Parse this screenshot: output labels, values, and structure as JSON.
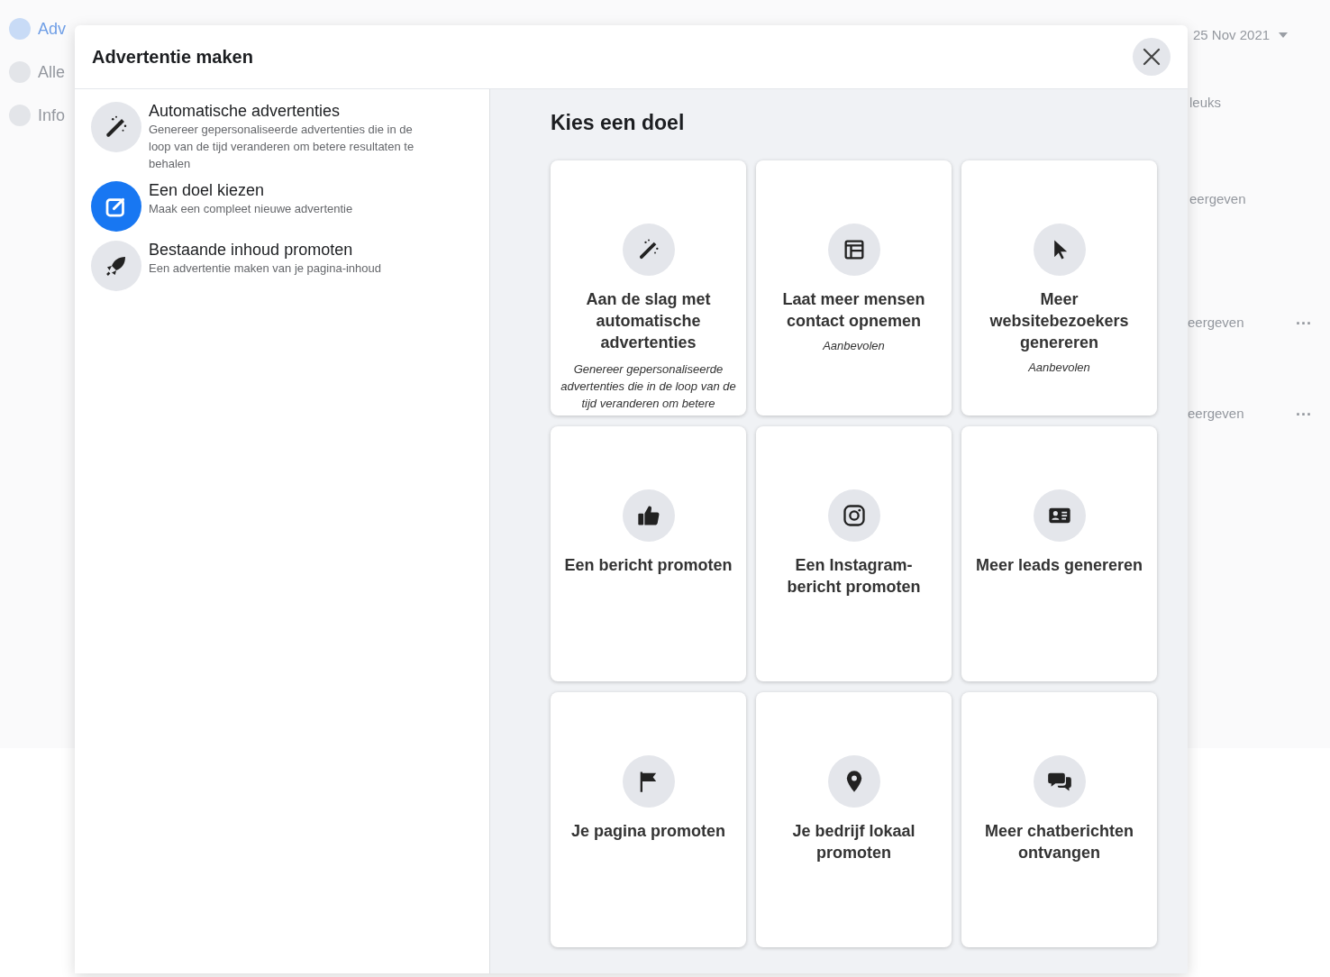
{
  "background": {
    "sidebar": [
      {
        "label": "Adv",
        "selected": true
      },
      {
        "label": "Alle",
        "selected": false
      },
      {
        "label": "Info",
        "selected": false
      }
    ],
    "date_range": "25 Nov 2021",
    "metric_label": "leuks",
    "row_actions": [
      "eergeven",
      "eergeven",
      "eergeven"
    ],
    "more_buttons": [
      "···",
      "···"
    ]
  },
  "dialog": {
    "title": "Advertentie maken",
    "options": [
      {
        "title": "Automatische advertenties",
        "description": "Genereer gepersonaliseerde advertenties die in de loop van de tijd veranderen om betere resultaten te behalen",
        "selected": false
      },
      {
        "title": "Een doel kiezen",
        "description": "Maak een compleet nieuwe advertentie",
        "selected": true
      },
      {
        "title": "Bestaande inhoud promoten",
        "description": "Een advertentie maken van je pagina-inhoud",
        "selected": false
      }
    ],
    "goal_heading": "Kies een doel",
    "goals": [
      {
        "title": "Aan de slag met automatische advertenties",
        "description": "Genereer gepersonaliseerde advertenties die in de loop van de tijd veranderen om betere"
      },
      {
        "title": "Laat meer mensen contact opnemen",
        "note": "Aanbevolen"
      },
      {
        "title": "Meer websitebezoekers genereren",
        "note": "Aanbevolen"
      },
      {
        "title": "Een bericht promoten"
      },
      {
        "title": "Een Instagram-bericht promoten"
      },
      {
        "title": "Meer leads genereren"
      },
      {
        "title": "Je pagina promoten"
      },
      {
        "title": "Je bedrijf lokaal promoten"
      },
      {
        "title": "Meer chatberichten ontvangen"
      }
    ]
  }
}
